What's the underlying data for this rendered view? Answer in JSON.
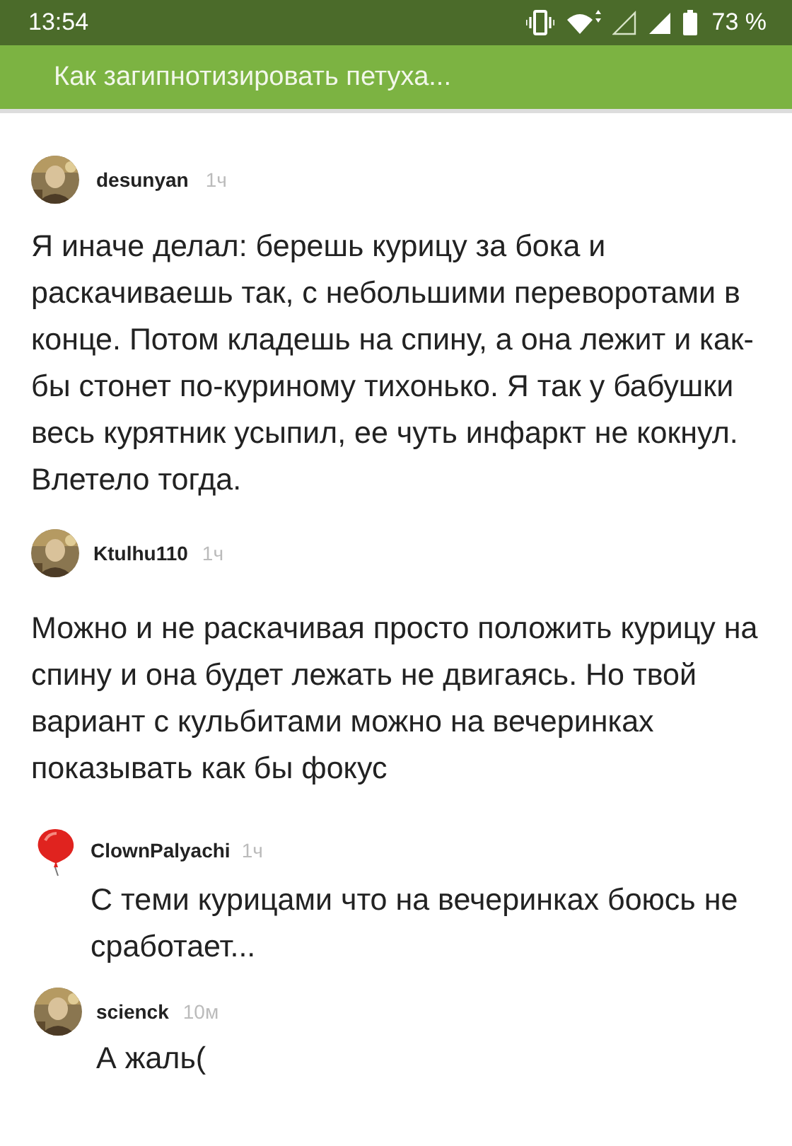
{
  "status_bar": {
    "time": "13:54",
    "battery": "73 %"
  },
  "header": {
    "title": "Как загипнотизировать петуха..."
  },
  "comments": [
    {
      "author": "desunyan",
      "time": "1ч",
      "text": "Я иначе делал: берешь курицу за бока и раскачиваешь так, с небольшими переворотами в конце. Потом кладешь на спину, а она лежит и как-бы стонет по-куриному тихонько. Я так у бабушки весь курятник усыпил, ее чуть инфаркт не кокнул. Влетело тогда.",
      "children": [
        {
          "author": "Ktulhu110",
          "time": "1ч",
          "text": "Можно и не раскачивая просто положить курицу на спину и она будет лежать не двигаясь. Но твой вариант с кульбитами можно на вечеринках показывать как бы фокус",
          "children": [
            {
              "author": "ClownPalyachi",
              "time": "1ч",
              "avatar": {
                "kind": "balloon"
              },
              "text": "С теми курицами что на вечеринках боюсь не сработает...",
              "children": [
                {
                  "author": "scienck",
                  "time": "10м",
                  "text": "А жаль("
                }
              ]
            }
          ]
        }
      ]
    }
  ]
}
